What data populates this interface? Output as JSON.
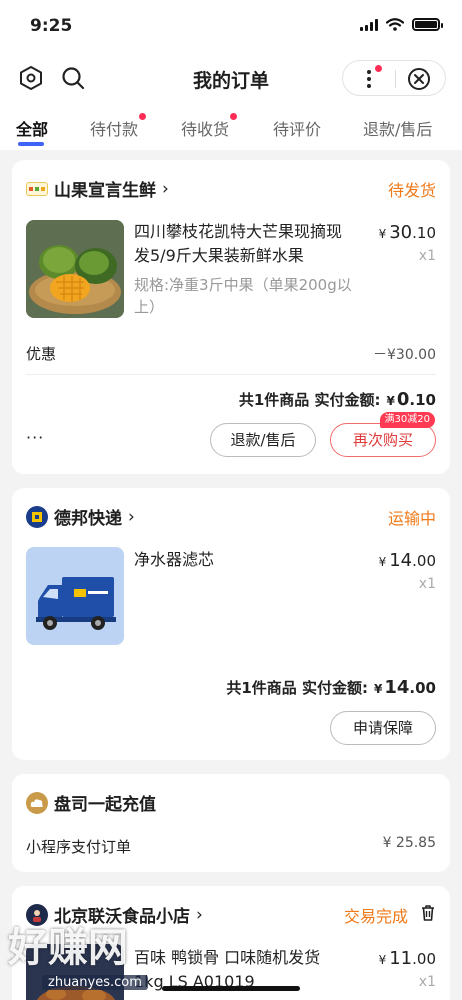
{
  "status_bar": {
    "time": "9:25"
  },
  "nav": {
    "title": "我的订单"
  },
  "tabs": [
    {
      "label": "全部",
      "active": true,
      "badge": false
    },
    {
      "label": "待付款",
      "active": false,
      "badge": true
    },
    {
      "label": "待收货",
      "active": false,
      "badge": true
    },
    {
      "label": "待评价",
      "active": false,
      "badge": false
    },
    {
      "label": "退款/售后",
      "active": false,
      "badge": false
    }
  ],
  "orders": [
    {
      "shop": "山果宣言生鲜",
      "status": "待发货",
      "product": "四川攀枝花凯特大芒果现摘现发5/9斤大果装新鲜水果",
      "spec": "规格:净重3斤中果（单果200g以上）",
      "price_int": "30",
      "price_dec": ".10",
      "qty": "x1",
      "discount_label": "优惠",
      "discount_value": "－¥30.00",
      "total_prefix": "共1件商品  实付金额:",
      "total_int": "0",
      "total_dec": ".10",
      "buttons": [
        "退款/售后",
        "再次购买"
      ],
      "button_tag": "满30减20",
      "more": "···"
    },
    {
      "shop": "德邦快递",
      "status": "运输中",
      "product": "净水器滤芯",
      "price_int": "14",
      "price_dec": ".00",
      "qty": "x1",
      "total_prefix": "共1件商品  实付金额:",
      "total_int": "14",
      "total_dec": ".00",
      "buttons": [
        "申请保障"
      ]
    },
    {
      "shop": "盘司一起充值",
      "row_label": "小程序支付订单",
      "row_value": "¥ 25.85"
    },
    {
      "shop": "北京联沃食品小店",
      "status": "交易完成",
      "product": "百味 鸭锁骨 口味随机发货 1kg LS A01019",
      "price_int": "11",
      "price_dec": ".00",
      "qty": "x1"
    }
  ],
  "currency": "¥",
  "watermark": {
    "big": "好赚网",
    "small": "zhuanyes.com"
  },
  "colors": {
    "accent": "#3d64f4",
    "status_orange": "#f07a1a",
    "badge_red": "#ff2d55"
  }
}
